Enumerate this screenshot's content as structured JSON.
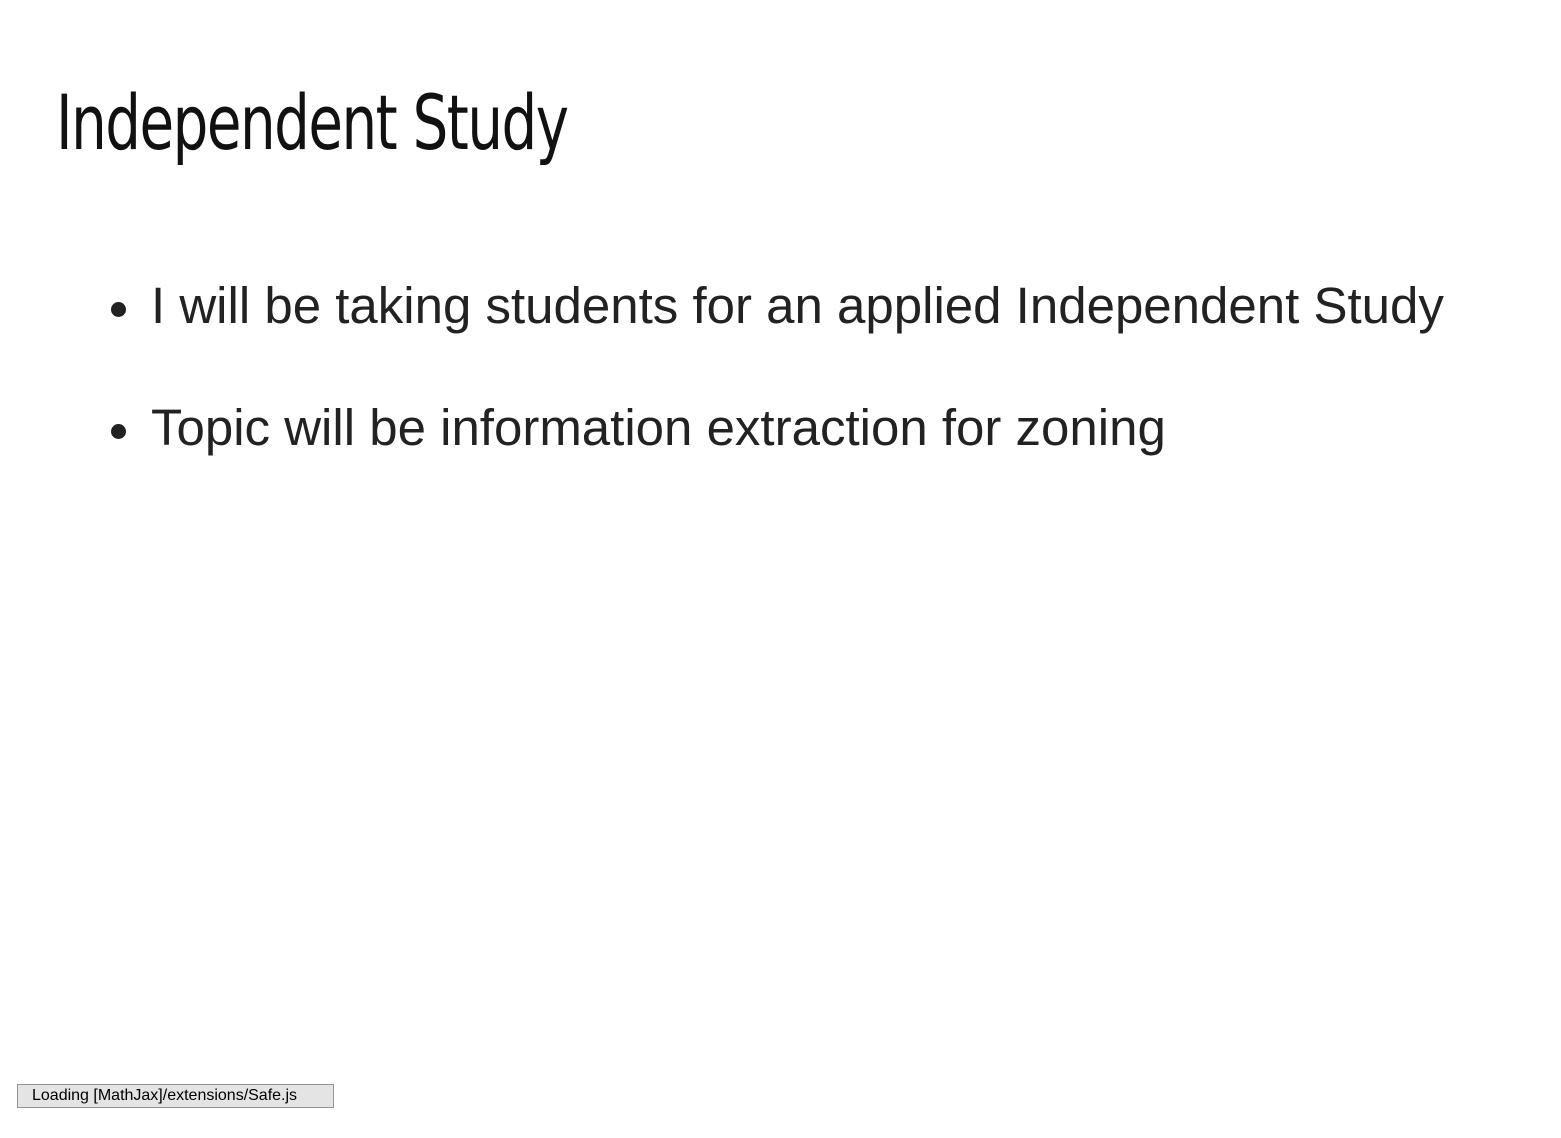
{
  "slide": {
    "title": "Independent Study",
    "bullets": [
      {
        "text": "I will be taking students for an applied Independent Study"
      },
      {
        "text": "Topic will be information extraction for zoning"
      }
    ]
  },
  "status": {
    "message": "Loading [MathJax]/extensions/Safe.js"
  },
  "colors": {
    "background": "#ffffff",
    "text": "#222222",
    "title": "#111111",
    "status_bg": "#e4e4e4",
    "status_border": "#959595"
  }
}
